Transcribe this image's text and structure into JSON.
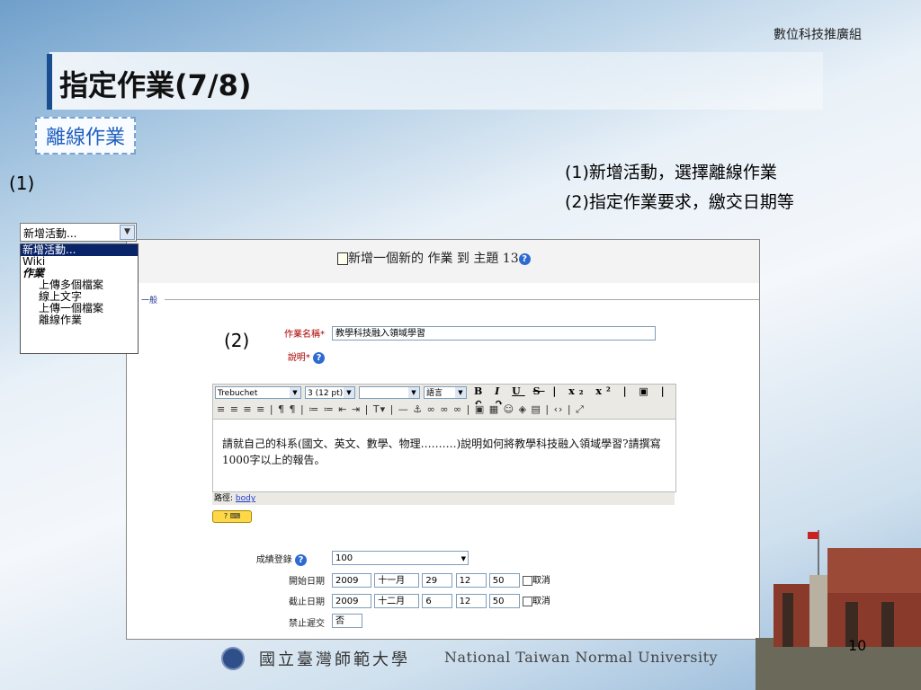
{
  "header": {
    "dept": "數位科技推廣組",
    "title": "指定作業(7/8)",
    "tag": "離線作業",
    "label1": "(1)",
    "notes": [
      "(1)新增活動，選擇離線作業",
      "(2)指定作業要求，繳交日期等"
    ]
  },
  "dropdown": {
    "selected": "新增活動...",
    "items": [
      {
        "label": "新增活動...",
        "selected": true
      },
      {
        "label": "Wiki"
      },
      {
        "label": "作業",
        "group": true
      },
      {
        "label": "上傳多個檔案",
        "indent": true
      },
      {
        "label": "線上文字",
        "indent": true
      },
      {
        "label": "上傳一個檔案",
        "indent": true
      },
      {
        "label": "離線作業",
        "indent": true
      }
    ]
  },
  "form": {
    "heading": "新增一個新的 作業 到 主題 13",
    "section": "一般",
    "label2": "(2)",
    "name_label": "作業名稱",
    "name_value": "教學科技融入領域學習",
    "desc_label": "說明",
    "toolbar": {
      "font": "Trebuchet",
      "size": "3 (12 pt)",
      "style": "",
      "lang": "語言",
      "row2": "≡ ≡ ≡ ≡ | ¶ ¶ | ≔ ≔ ⇤ ⇥ | T▾ | — ⚓ ∞ ∞ ∞ | ▣ ▦ ☺ ◈ ▤ | ‹› | ⤢"
    },
    "editor_text": "請就自己的科系(國文、英文、數學、物理……….)說明如何將教學科技融入領域學習?請撰寫1000字以上的報告。",
    "path_label": "路徑:",
    "path_link": "body",
    "grade_label": "成績登錄",
    "grade_value": "100",
    "start_label": "開始日期",
    "end_label": "截止日期",
    "late_label": "禁止遲交",
    "late_value": "否",
    "start": {
      "year": "2009",
      "month": "十一月",
      "day": "29",
      "hour": "12",
      "min": "50",
      "cancel": "取消"
    },
    "end": {
      "year": "2009",
      "month": "十二月",
      "day": "6",
      "hour": "12",
      "min": "50",
      "cancel": "取消"
    }
  },
  "footer": {
    "chinese": "國立臺灣師範大學",
    "english": "National Taiwan Normal University",
    "page": "10"
  },
  "colors": {
    "title_bar": "#1a4d8f",
    "tag_text": "#1f5fbf",
    "selected_item": "#0a246a"
  }
}
